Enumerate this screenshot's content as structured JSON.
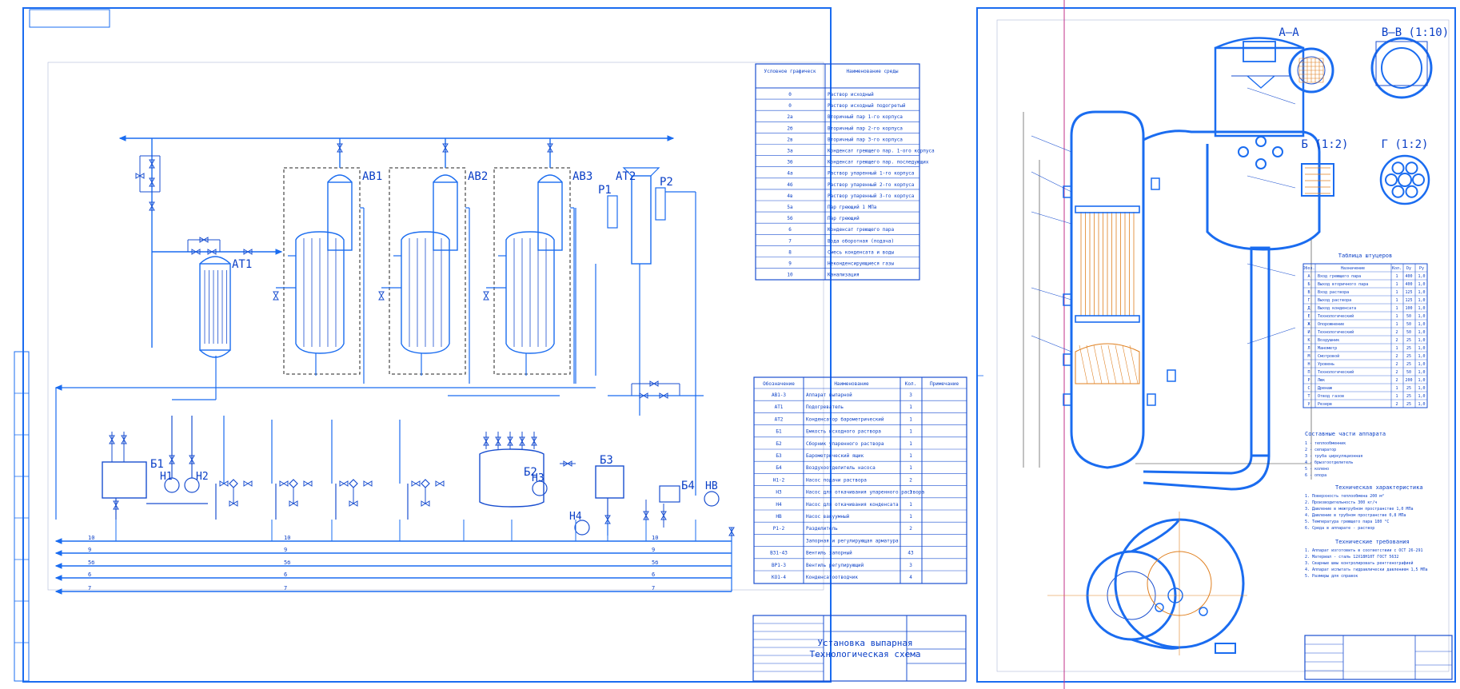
{
  "colors": {
    "line": "#1a4fd0",
    "bright": "#1a6cf0",
    "text": "#0a3fc6",
    "accent": "#c0308a"
  },
  "sheet1": {
    "legend_headers": [
      "Условное графическое обозначение",
      "Наименование среды в трубопроводе"
    ],
    "legend": [
      [
        "0",
        "Раствор исходный"
      ],
      [
        "0",
        "Раствор исходный подогретый"
      ],
      [
        "2а",
        "Вторичный пар 1-го корпуса"
      ],
      [
        "2б",
        "Вторичный пар 2-го корпуса"
      ],
      [
        "2в",
        "Вторичный пар 3-го корпуса"
      ],
      [
        "3а",
        "Конденсат греющего пар. 1-ого корпуса"
      ],
      [
        "3б",
        "Конденсат греющего пар. последующих"
      ],
      [
        "4а",
        "Раствор упаренный 1-го корпуса"
      ],
      [
        "4б",
        "Раствор упаренный 2-го корпуса"
      ],
      [
        "4в",
        "Раствор упаренный 3-го корпуса"
      ],
      [
        "5а",
        "Пар греющий 1 МПа"
      ],
      [
        "5б",
        "Пар греющий"
      ],
      [
        "6",
        "Конденсат греющего пара"
      ],
      [
        "7",
        "Вода оборотная (подача)"
      ],
      [
        "8",
        "Смесь конденсата и воды"
      ],
      [
        "9",
        "Неконденсирующиеся газы"
      ],
      [
        "10",
        "Канализация"
      ]
    ],
    "spec_headers": [
      "Обозначение",
      "Наименование",
      "Кол.",
      "Примечание"
    ],
    "spec": [
      [
        "АВ1-3",
        "Аппарат выпарной",
        "3",
        ""
      ],
      [
        "АТ1",
        "Подогреватель",
        "1",
        ""
      ],
      [
        "АТ2",
        "Конденсатор барометрический",
        "1",
        ""
      ],
      [
        "Б1",
        "Емкость исходного раствора",
        "1",
        ""
      ],
      [
        "Б2",
        "Сборник упаренного раствора",
        "1",
        ""
      ],
      [
        "Б3",
        "Барометрический ящик",
        "1",
        ""
      ],
      [
        "Б4",
        "Воздухоотделитель насоса",
        "1",
        ""
      ],
      [
        "Н1-2",
        "Насос подачи раствора",
        "2",
        ""
      ],
      [
        "Н3",
        "Насос для откачивания упаренного раствора",
        "1",
        ""
      ],
      [
        "Н4",
        "Насос для откачивания конденсата",
        "1",
        ""
      ],
      [
        "НВ",
        "Насос вакуумный",
        "1",
        ""
      ],
      [
        "Р1-2",
        "Разделитель",
        "2",
        ""
      ],
      [
        "",
        "Запорная и регулирующая арматура",
        "",
        ""
      ],
      [
        "ВЗ1-43",
        "Вентиль запорный",
        "43",
        ""
      ],
      [
        "ВР1-3",
        "Вентиль регулирующий",
        "3",
        ""
      ],
      [
        "КО1-4",
        "Конденсатоотводчик",
        "4",
        ""
      ]
    ],
    "title": "Установка выпарная",
    "subtitle": "Технологическая схема",
    "equipment_labels": {
      "av1": "АВ1",
      "av2": "АВ2",
      "av3": "АВ3",
      "at1": "АТ1",
      "at2": "АТ2",
      "p1": "Р1",
      "p2": "Р2",
      "b1": "Б1",
      "b2": "Б2",
      "b3": "Б3",
      "b4": "Б4",
      "h1": "Н1",
      "h2": "Н2",
      "h3": "Н3",
      "h4": "Н4",
      "hb": "НВ"
    },
    "line_labels": [
      "10",
      "9",
      "5б",
      "6",
      "7"
    ]
  },
  "sheet2": {
    "section_aa": "А–А",
    "section_vv": "В–В (1:10)",
    "section_b": "Б (1:2)",
    "section_g": "Г (1:2)",
    "nozzle_table_title": "Таблица штуцеров",
    "nozzle_headers": [
      "Обоз.",
      "Назначение",
      "Кол.",
      "Dу",
      "Pу"
    ],
    "nozzle_rows": [
      [
        "А",
        "Вход греющего пара",
        "1",
        "400",
        "1,0"
      ],
      [
        "Б",
        "Выход вторичного пара",
        "1",
        "400",
        "1,0"
      ],
      [
        "В",
        "Вход раствора",
        "1",
        "125",
        "1,0"
      ],
      [
        "Г",
        "Выход раствора",
        "1",
        "125",
        "1,0"
      ],
      [
        "Д",
        "Выход конденсата",
        "1",
        "100",
        "1,0"
      ],
      [
        "Е",
        "Технологический",
        "1",
        "50",
        "1,0"
      ],
      [
        "Ж",
        "Опорожнение",
        "1",
        "50",
        "1,0"
      ],
      [
        "И",
        "Технологический",
        "2",
        "50",
        "1,0"
      ],
      [
        "К",
        "Воздушник",
        "2",
        "25",
        "1,0"
      ],
      [
        "Л",
        "Манометр",
        "1",
        "25",
        "1,0"
      ],
      [
        "М",
        "Смотровой",
        "2",
        "25",
        "1,0"
      ],
      [
        "Н",
        "Уровень",
        "2",
        "25",
        "1,0"
      ],
      [
        "П",
        "Технологический",
        "2",
        "50",
        "1,0"
      ],
      [
        "Р",
        "Люк",
        "2",
        "200",
        "1,0"
      ],
      [
        "С",
        "Дренаж",
        "1",
        "25",
        "1,0"
      ],
      [
        "Т",
        "Отвод газов",
        "1",
        "25",
        "1,0"
      ],
      [
        "У",
        "Резерв",
        "2",
        "25",
        "1,0"
      ]
    ],
    "parts_title": "Составные части аппарата",
    "parts": [
      "1 - теплообменник",
      "2 - сепаратор",
      "3 - труба циркуляционная",
      "4 - брызгоотделитель",
      "5 - колено",
      "6 - опора"
    ],
    "tech_title": "Техническая характеристика",
    "tech": [
      "1. Поверхность теплообмена 200 м²",
      "2. Производительность 300 кг/ч",
      "3. Давление в межтрубном пространстве 1,0 МПа",
      "4. Давление в трубном пространстве 0,8 МПа",
      "5. Температура греющего пара 180 °С",
      "6. Среда в аппарате - раствор"
    ],
    "req_title": "Технические требования",
    "req": [
      "1. Аппарат изготовить в соответствии с ОСТ 26-291",
      "2. Материал - сталь 12Х18Н10Т ГОСТ 5632",
      "3. Сварные швы контролировать рентгенографией",
      "4. Аппарат испытать гидравлически давлением 1,5 МПа",
      "5. Размеры для справок"
    ]
  }
}
